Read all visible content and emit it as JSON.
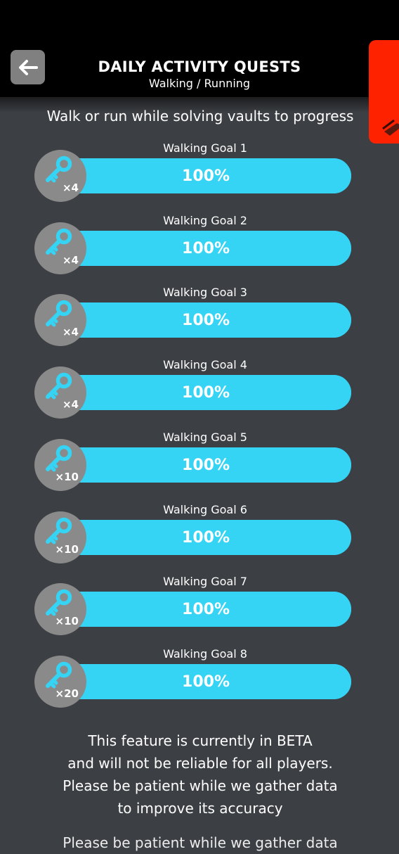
{
  "header": {
    "title": "DAILY ACTIVITY QUESTS",
    "subtitle": "Walking / Running"
  },
  "instruction": "Walk or run while solving vaults to progress",
  "goals": [
    {
      "label": "Walking Goal 1",
      "progress_text": "100%",
      "progress": 1.0,
      "reward": "×4"
    },
    {
      "label": "Walking Goal 2",
      "progress_text": "100%",
      "progress": 1.0,
      "reward": "×4"
    },
    {
      "label": "Walking Goal 3",
      "progress_text": "100%",
      "progress": 1.0,
      "reward": "×4"
    },
    {
      "label": "Walking Goal 4",
      "progress_text": "100%",
      "progress": 1.0,
      "reward": "×4"
    },
    {
      "label": "Walking Goal 5",
      "progress_text": "100%",
      "progress": 1.0,
      "reward": "×10"
    },
    {
      "label": "Walking Goal 6",
      "progress_text": "100%",
      "progress": 1.0,
      "reward": "×10"
    },
    {
      "label": "Walking Goal 7",
      "progress_text": "100%",
      "progress": 1.0,
      "reward": "×10"
    },
    {
      "label": "Walking Goal 8",
      "progress_text": "100%",
      "progress": 1.0,
      "reward": "×20"
    }
  ],
  "beta_note": {
    "line1": "This feature is currently in BETA",
    "line2": "and will not be reliable for all players.",
    "line3": "Please be patient while we gather data",
    "line4": "to improve its accuracy"
  },
  "colors": {
    "background": "#3c3f43",
    "header": "#000000",
    "progress": "#35d3f4",
    "reward_circle": "#8a8a8a",
    "key": "#35d3f4",
    "side_badge": "#ff2200"
  },
  "icons": {
    "back": "back-arrow-icon",
    "reward": "key-icon"
  }
}
